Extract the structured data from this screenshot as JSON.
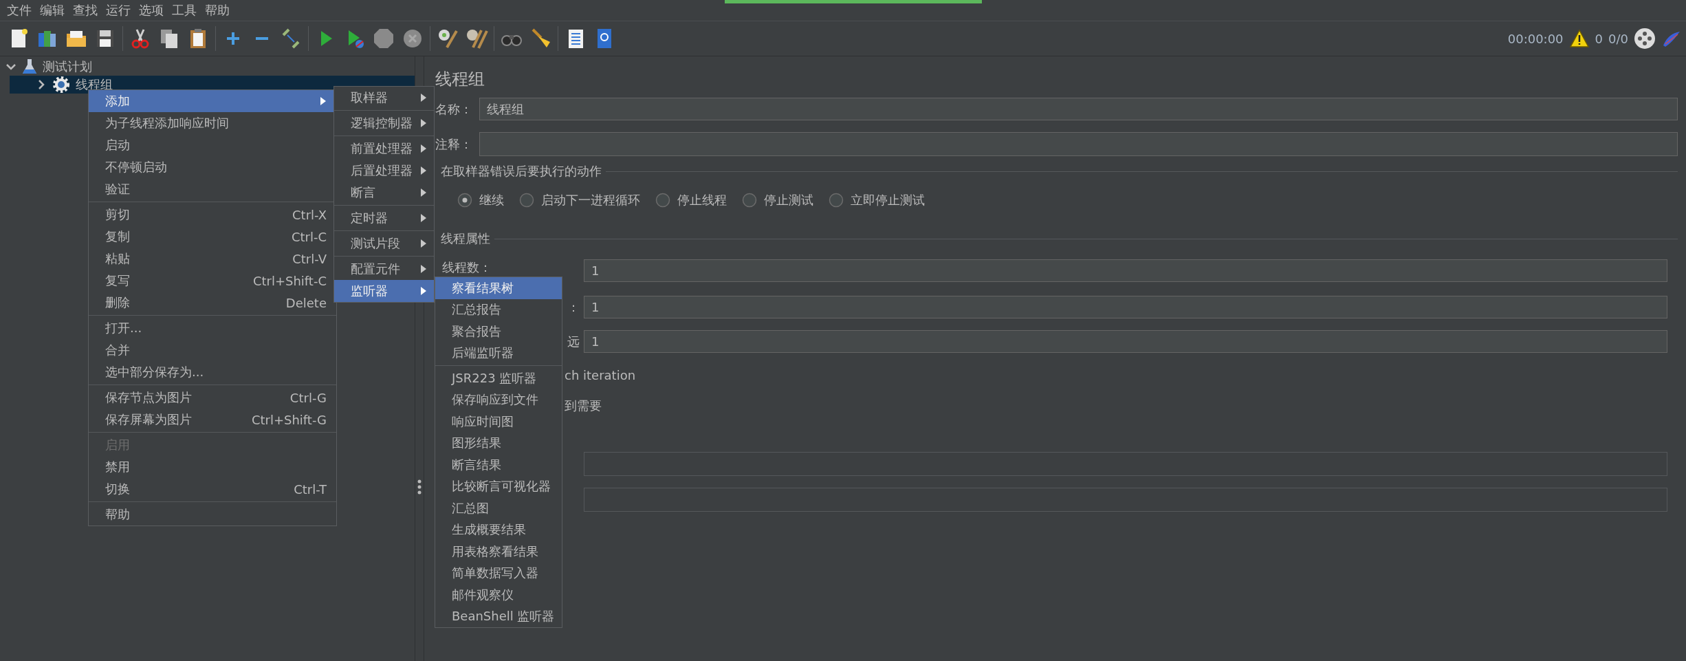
{
  "menubar": [
    "文件",
    "编辑",
    "查找",
    "运行",
    "选项",
    "工具",
    "帮助"
  ],
  "status": {
    "elapsed": "00:00:00",
    "warnings": "0",
    "threads": "0/0"
  },
  "tree": [
    {
      "label": "测试计划",
      "expanded": true,
      "selected": false,
      "children": [
        {
          "label": "线程组",
          "expanded": false,
          "selected": true
        }
      ]
    }
  ],
  "context_menu": {
    "groups": [
      [
        {
          "label": "添加",
          "submenu": true,
          "selected": true,
          "disabled": false
        },
        {
          "label": "为子线程添加响应时间",
          "submenu": false,
          "selected": false,
          "disabled": false
        },
        {
          "label": "启动",
          "submenu": false,
          "selected": false,
          "disabled": false
        },
        {
          "label": "不停顿启动",
          "submenu": false,
          "selected": false,
          "disabled": false
        },
        {
          "label": "验证",
          "submenu": false,
          "selected": false,
          "disabled": false
        }
      ],
      [
        {
          "label": "剪切",
          "shortcut": "Ctrl-X",
          "submenu": false,
          "selected": false,
          "disabled": false
        },
        {
          "label": "复制",
          "shortcut": "Ctrl-C",
          "submenu": false,
          "selected": false,
          "disabled": false
        },
        {
          "label": "粘贴",
          "shortcut": "Ctrl-V",
          "submenu": false,
          "selected": false,
          "disabled": false
        },
        {
          "label": "复写",
          "shortcut": "Ctrl+Shift-C",
          "submenu": false,
          "selected": false,
          "disabled": false
        },
        {
          "label": "删除",
          "shortcut": "Delete",
          "submenu": false,
          "selected": false,
          "disabled": false
        }
      ],
      [
        {
          "label": "打开...",
          "submenu": false,
          "selected": false,
          "disabled": false
        },
        {
          "label": "合并",
          "submenu": false,
          "selected": false,
          "disabled": false
        },
        {
          "label": "选中部分保存为...",
          "submenu": false,
          "selected": false,
          "disabled": false
        }
      ],
      [
        {
          "label": "保存节点为图片",
          "shortcut": "Ctrl-G",
          "submenu": false,
          "selected": false,
          "disabled": false
        },
        {
          "label": "保存屏幕为图片",
          "shortcut": "Ctrl+Shift-G",
          "submenu": false,
          "selected": false,
          "disabled": false
        }
      ],
      [
        {
          "label": "启用",
          "submenu": false,
          "selected": false,
          "disabled": true
        },
        {
          "label": "禁用",
          "submenu": false,
          "selected": false,
          "disabled": false
        },
        {
          "label": "切换",
          "shortcut": "Ctrl-T",
          "submenu": false,
          "selected": false,
          "disabled": false
        }
      ],
      [
        {
          "label": "帮助",
          "submenu": false,
          "selected": false,
          "disabled": false
        }
      ]
    ]
  },
  "add_submenu": {
    "groups": [
      [
        {
          "label": "取样器",
          "submenu": true,
          "selected": false
        }
      ],
      [
        {
          "label": "逻辑控制器",
          "submenu": true,
          "selected": false
        }
      ],
      [
        {
          "label": "前置处理器",
          "submenu": true,
          "selected": false
        },
        {
          "label": "后置处理器",
          "submenu": true,
          "selected": false
        },
        {
          "label": "断言",
          "submenu": true,
          "selected": false
        }
      ],
      [
        {
          "label": "定时器",
          "submenu": true,
          "selected": false
        }
      ],
      [
        {
          "label": "测试片段",
          "submenu": true,
          "selected": false
        }
      ],
      [
        {
          "label": "配置元件",
          "submenu": true,
          "selected": false
        },
        {
          "label": "监听器",
          "submenu": true,
          "selected": true
        }
      ]
    ]
  },
  "listener_submenu": {
    "groups": [
      [
        {
          "label": "察看结果树",
          "submenu": false,
          "selected": true
        },
        {
          "label": "汇总报告",
          "submenu": false,
          "selected": false
        },
        {
          "label": "聚合报告",
          "submenu": false,
          "selected": false
        },
        {
          "label": "后端监听器",
          "submenu": false,
          "selected": false
        }
      ],
      [
        {
          "label": "JSR223 监听器",
          "submenu": false,
          "selected": false
        },
        {
          "label": "保存响应到文件",
          "submenu": false,
          "selected": false
        },
        {
          "label": "响应时间图",
          "submenu": false,
          "selected": false
        },
        {
          "label": "图形结果",
          "submenu": false,
          "selected": false
        },
        {
          "label": "断言结果",
          "submenu": false,
          "selected": false
        },
        {
          "label": "比较断言可视化器",
          "submenu": false,
          "selected": false
        },
        {
          "label": "汇总图",
          "submenu": false,
          "selected": false
        },
        {
          "label": "生成概要结果",
          "submenu": false,
          "selected": false
        },
        {
          "label": "用表格察看结果",
          "submenu": false,
          "selected": false
        },
        {
          "label": "简单数据写入器",
          "submenu": false,
          "selected": false
        },
        {
          "label": "邮件观察仪",
          "submenu": false,
          "selected": false
        },
        {
          "label": "BeanShell 监听器",
          "submenu": false,
          "selected": false
        }
      ]
    ]
  },
  "editor": {
    "title": "线程组",
    "name_label": "名称：",
    "name_value": "线程组",
    "comment_label": "注释：",
    "error_action": {
      "title": "在取样器错误后要执行的动作",
      "options": [
        {
          "label": "继续",
          "selected": true
        },
        {
          "label": "启动下一进程循环",
          "selected": false
        },
        {
          "label": "停止线程",
          "selected": false
        },
        {
          "label": "停止测试",
          "selected": false
        },
        {
          "label": "立即停止测试",
          "selected": false
        }
      ]
    },
    "thread_properties": {
      "title": "线程属性",
      "rows": [
        {
          "label": "线程数：",
          "value": "1"
        },
        {
          "label": "：",
          "value": "1"
        },
        {
          "label": "远",
          "value": "1"
        }
      ],
      "fragments": [
        "ch iteration",
        "到需要"
      ],
      "extra_fields": [
        {
          "disabled": true
        },
        {
          "disabled": true
        }
      ]
    }
  }
}
